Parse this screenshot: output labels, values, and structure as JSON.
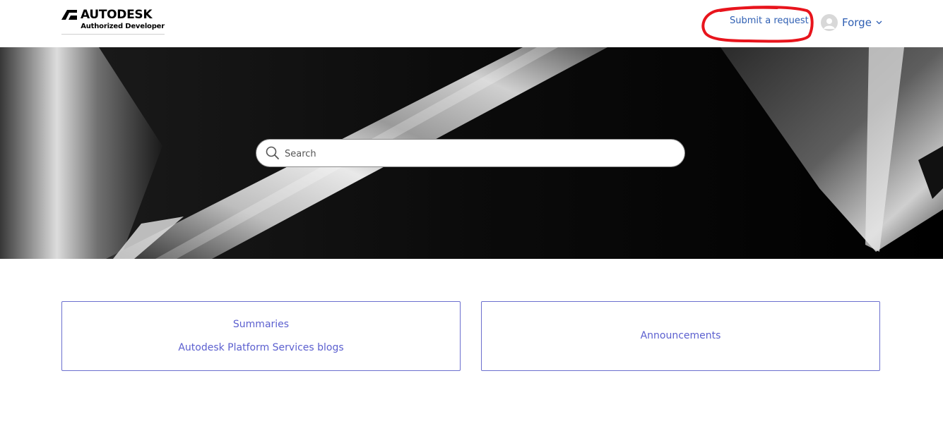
{
  "header": {
    "logo": {
      "wordmark": "AUTODESK",
      "subtitle": "Authorized Developer"
    },
    "submit_request_label": "Submit a request",
    "user": {
      "name": "Forge",
      "avatar_icon": "user-avatar-icon",
      "dropdown_icon": "chevron-down-icon"
    },
    "highlight_color": "#e8141c"
  },
  "hero": {
    "search": {
      "placeholder": "Search",
      "icon": "search-icon"
    }
  },
  "cards": [
    {
      "links": [
        "Summaries",
        "Autodesk Platform Services blogs"
      ]
    },
    {
      "links": [
        "Announcements"
      ]
    }
  ],
  "colors": {
    "link": "#2f5fb3",
    "card_link": "#5b5fcf",
    "card_border": "#6b6fce"
  }
}
